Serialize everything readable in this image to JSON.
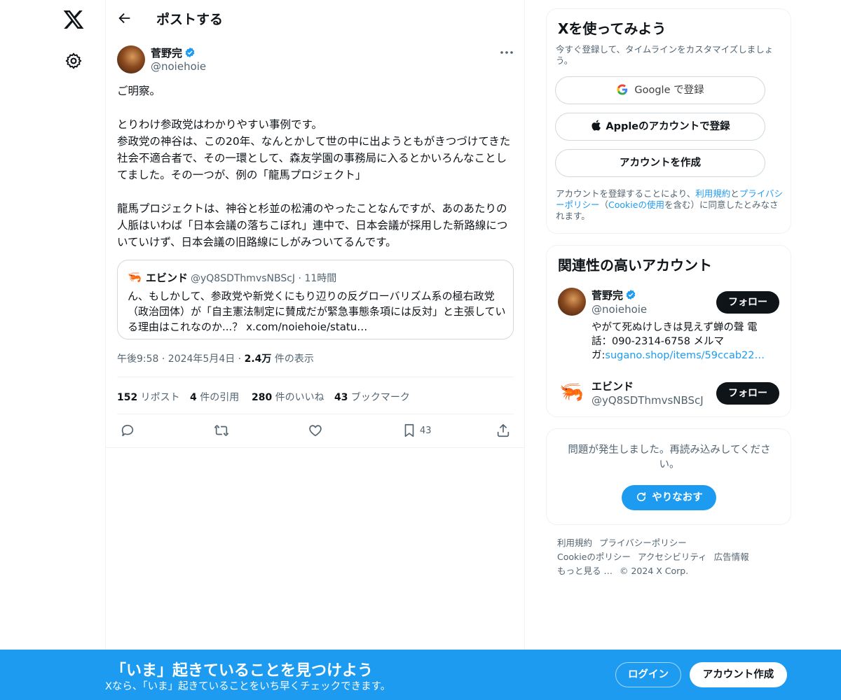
{
  "nav": {
    "logo_icon": "x-logo-icon",
    "settings_icon": "gear-icon"
  },
  "header": {
    "title": "ポストする"
  },
  "tweet": {
    "author_name": "菅野完",
    "author_handle": "@noiehoie",
    "text": "ご明察。\n\nとりわけ参政党はわかりやすい事例です。\n参政党の神谷は、この20年、なんとかして世の中に出ようともがきつづけてきた社会不適合者で、その一環として、森友学園の事務局に入るとかいろんなことしてました。その一つが、例の「龍馬プロジェクト」\n\n龍馬プロジェクトは、神谷と杉並の松浦のやったことなんですが、あのあたりの人脈はいわば「日本会議の落ちこぼれ」連中で、日本会議が採用した新路線についていけず、日本会議の旧路線にしがみついてるんです。",
    "quote": {
      "name": "エビンド",
      "handle": "@yQ8SDThmvsNBScJ",
      "time": "11時間",
      "text": "ん、もしかして、参政党や新党くにもり辺りの反グローバリズム系の極右政党（政治団体）が「自主憲法制定に賛成だが緊急事態条項には反対」と主張している理由はこれなのか...？ x.com/noiehoie/statu…"
    },
    "timestamp": "午後9:58 · 2024年5月4日 · ",
    "views_count": "2.4万",
    "views_label": " 件の表示",
    "stats": {
      "reposts_count": "152",
      "reposts_label": " リポスト",
      "quotes_count": "4",
      "quotes_label": " 件の引用",
      "likes_count": "280",
      "likes_label": " 件のいいね",
      "bookmarks_count": "43",
      "bookmarks_label": " ブックマーク"
    },
    "bookmark_action_count": "43"
  },
  "signup_card": {
    "title": "Xを使ってみよう",
    "subtitle": "今すぐ登録して、タイムラインをカスタマイズしましょう。",
    "google_label": "Google で登録",
    "apple_label": "Appleのアカウントで登録",
    "create_label": "アカウントを作成",
    "legal_pre": "アカウントを登録することにより、",
    "legal_terms": "利用規約",
    "legal_and": "と",
    "legal_privacy": "プライバシーポリシー",
    "legal_mid": "（",
    "legal_cookie": "Cookieの使用",
    "legal_post": "を含む）に同意したとみなされます。"
  },
  "related": {
    "title": "関連性の高いアカウント",
    "accounts": [
      {
        "name": "菅野完",
        "handle": "@noiehoie",
        "bio_text": "やがて死ぬけしきは見えず蝉の聲 電話：090-2314-6758 メルマガ:",
        "bio_link": "sugano.shop/items/59ccab22…",
        "follow_label": "フォロー"
      },
      {
        "name": "エビンド",
        "handle": "@yQ8SDThmvsNBScJ",
        "follow_label": "フォロー"
      }
    ]
  },
  "error_card": {
    "message": "問題が発生しました。再読み込みしてください。",
    "retry_label": "やりなおす"
  },
  "footer": {
    "links": [
      "利用規約",
      "プライバシーポリシー",
      "Cookieのポリシー",
      "アクセシビリティ",
      "広告情報",
      "もっと見る …",
      "© 2024 X Corp."
    ]
  },
  "bottom_bar": {
    "title": "「いま」起きていることを見つけよう",
    "subtitle": "Xなら、「いま」起きていることをいち早くチェックできます。",
    "login_label": "ログイン",
    "signup_label": "アカウント作成"
  },
  "colors": {
    "accent": "#1d9bf0",
    "text": "#0f1419",
    "muted": "#536471"
  }
}
